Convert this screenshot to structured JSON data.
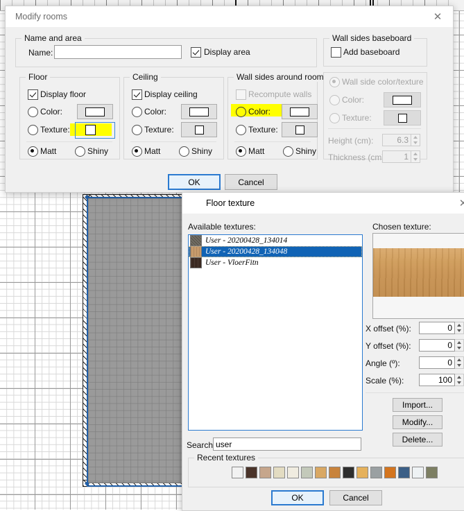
{
  "app": {
    "canvas": {
      "name": "floor-plan-canvas",
      "room_fill": "#9a9a9a",
      "selection_color": "#1f5fa9"
    }
  },
  "modify_rooms_dialog": {
    "title": "Modify rooms",
    "close_icon": "close-icon",
    "name_and_area": {
      "legend": "Name and area",
      "name_label": "Name:",
      "name_value": "",
      "name_placeholder": "",
      "display_area_label": "Display area",
      "display_area_checked": true
    },
    "floor": {
      "legend": "Floor",
      "display_label": "Display floor",
      "display_checked": true,
      "color_label": "Color:",
      "color_selected": false,
      "texture_label": "Texture:",
      "texture_selected": false,
      "texture_highlighted": true,
      "matt_label": "Matt",
      "shiny_label": "Shiny",
      "shine": "Matt"
    },
    "ceiling": {
      "legend": "Ceiling",
      "display_label": "Display ceiling",
      "display_checked": true,
      "color_label": "Color:",
      "color_selected": false,
      "texture_label": "Texture:",
      "texture_selected": false,
      "matt_label": "Matt",
      "shiny_label": "Shiny",
      "shine": "Matt"
    },
    "wall_sides": {
      "legend": "Wall sides around room",
      "recompute_label": "Recompute walls",
      "recompute_checked": false,
      "recompute_enabled": false,
      "color_label": "Color:",
      "color_highlighted": true,
      "texture_label": "Texture:",
      "matt_label": "Matt",
      "shiny_label": "Shiny",
      "shine": "Matt"
    },
    "baseboard": {
      "legend": "Wall sides baseboard",
      "add_label": "Add baseboard",
      "add_checked": false,
      "wall_side_color_texture_label": "Wall side color/texture",
      "wall_side_selected": true,
      "color_label": "Color:",
      "texture_label": "Texture:",
      "height_label": "Height (cm):",
      "height_value": "6.3",
      "thickness_label": "Thickness (cm):",
      "thickness_value": "1",
      "enabled": false
    },
    "ok_label": "OK",
    "cancel_label": "Cancel"
  },
  "floor_texture_dialog": {
    "title": "Floor texture",
    "app_icon": "house-hexagon-icon",
    "close_icon": "close-icon",
    "available_label": "Available textures:",
    "textures": [
      {
        "name": "User - 20200428_134014",
        "selected": false,
        "swatch": "#5f5a50"
      },
      {
        "name": "User - 20200428_134048",
        "selected": true,
        "swatch": "#c79b6c"
      },
      {
        "name": "User - VloerFitn",
        "selected": false,
        "swatch": "#3b2a22"
      }
    ],
    "chosen_label": "Chosen texture:",
    "chosen_preview": "wood-plank-texture",
    "fields": [
      {
        "label": "X offset (%):",
        "value": "0"
      },
      {
        "label": "Y offset (%):",
        "value": "0"
      },
      {
        "label": "Angle (º):",
        "value": "0"
      },
      {
        "label": "Scale (%):",
        "value": "100"
      }
    ],
    "import_label": "Import...",
    "modify_label": "Modify...",
    "delete_label": "Delete...",
    "search_label": "Search:",
    "search_value": "user",
    "search_placeholder": "",
    "recent_label": "Recent textures",
    "recent_swatches": [
      "#f2f2f2",
      "#4a342a",
      "#c6a68c",
      "#e3dcc2",
      "#f0ece0",
      "#c3c9ba",
      "#d9a864",
      "#c8833c",
      "#2e2e2e",
      "#e5b15c",
      "#9aa0a2",
      "#d4751f",
      "#3b5f86",
      "#eef2f4",
      "#7d7f63"
    ],
    "ok_label": "OK",
    "cancel_label": "Cancel"
  }
}
